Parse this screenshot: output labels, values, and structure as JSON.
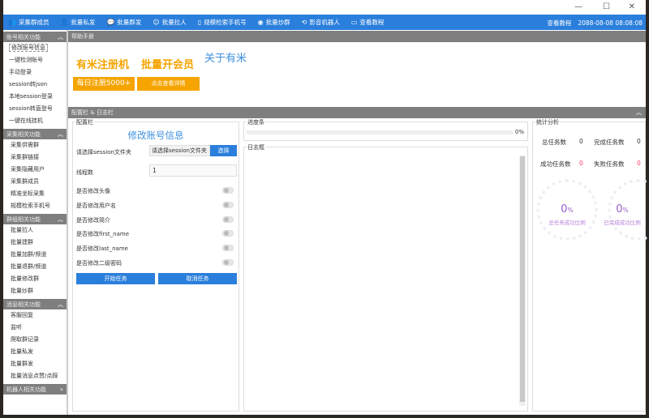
{
  "window": {
    "minimize": "—",
    "maximize": "☐",
    "close": "✕"
  },
  "toolbar": {
    "items": [
      {
        "icon": "users-icon",
        "glyph": "👥",
        "label": "采集群成员"
      },
      {
        "icon": "user-send-icon",
        "glyph": "👤",
        "label": "批量私发"
      },
      {
        "icon": "chat-icon",
        "glyph": "💬",
        "label": "批量群发"
      },
      {
        "icon": "user-add-icon",
        "glyph": "☺",
        "label": "批量拉人"
      },
      {
        "icon": "phone-icon",
        "glyph": "▯",
        "label": "规模检索手机号"
      },
      {
        "icon": "fire-icon",
        "glyph": "◉",
        "label": "批量炒群"
      },
      {
        "icon": "robot-icon",
        "glyph": "⟲",
        "label": "影音机器人"
      },
      {
        "icon": "book-icon",
        "glyph": "▭",
        "label": "查看教程"
      }
    ],
    "right_link": "查看教程",
    "datetime": "2088-08-08 08:08:08"
  },
  "sidebar": {
    "groups": [
      {
        "title": "账号相关功能",
        "items": [
          "修改账号信息",
          "一键检测账号",
          "手动登录",
          "session转json",
          "本地session登录",
          "session转直登号",
          "一键在线挂机"
        ]
      },
      {
        "title": "采集相关功能",
        "items": [
          "采集供需群",
          "采集群链接",
          "采集隐藏用户",
          "采集群成员",
          "精准坐标采集",
          "规模检索手机号"
        ]
      },
      {
        "title": "群组相关功能",
        "items": [
          "批量拉人",
          "批量建群",
          "批量加群/频道",
          "批量退群/频道",
          "批量修改群",
          "批量炒群"
        ]
      },
      {
        "title": "消息相关功能",
        "items": [
          "客服回复",
          "监听",
          "爬取群记录",
          "批量私发",
          "批量群发",
          "批量消息点赞/点踩"
        ]
      },
      {
        "title": "机器人相关功能",
        "items": []
      }
    ]
  },
  "help": {
    "title": "帮助手册",
    "ad1": "有米注册机",
    "ad2": "批量开会员",
    "about": "关于有米",
    "btn1": "每日注册5000+",
    "btn2": "点击查看详情"
  },
  "section": {
    "title": "配置栏 & 日志栏"
  },
  "config": {
    "label": "配置栏",
    "heading": "修改账号信息",
    "session_label": "请选择session文件夹",
    "session_placeholder": "请选择session文件夹",
    "choose": "选择",
    "threads_label": "线程数",
    "threads_value": "1",
    "toggles": [
      "是否修改头像",
      "是否修改用户名",
      "是否修改简介",
      "是否修改first_name",
      "是否修改last_name",
      "是否修改二级密码"
    ],
    "start": "开始任务",
    "cancel": "取消任务"
  },
  "progress": {
    "label": "进度条",
    "value": "0%",
    "fraction": 0,
    "log_label": "日志框"
  },
  "stats": {
    "label": "统计分析",
    "total_label": "总任务数",
    "total": "0",
    "done_label": "完成任务数",
    "done": "0",
    "success_label": "成功任务数",
    "success": "0",
    "fail_label": "失败任务数",
    "fail": "0",
    "ring1_value": "0",
    "ring1_unit": "%",
    "ring1_label": "总任务成功比例",
    "ring2_value": "0",
    "ring2_unit": "%",
    "ring2_label": "已完成成功比例",
    "zero_color": "#ff3d6e"
  }
}
